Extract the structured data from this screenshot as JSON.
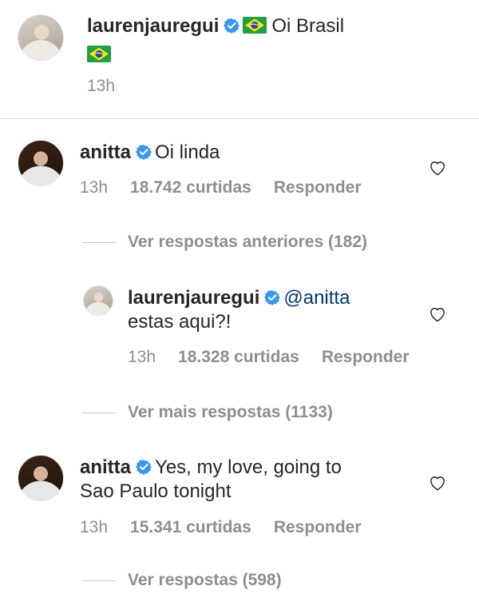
{
  "post": {
    "username": "laurenjauregui",
    "caption_text": "Oi Brasil",
    "time": "13h"
  },
  "comments": [
    {
      "username": "anitta",
      "text": "Oi linda",
      "time": "13h",
      "likes": "18.742 curtidas",
      "reply_label": "Responder",
      "replies_link": "Ver respostas anteriores (182)"
    },
    {
      "username": "laurenjauregui",
      "mention": "@anitta",
      "text": "estas aqui?!",
      "time": "13h",
      "likes": "18.328 curtidas",
      "reply_label": "Responder",
      "replies_link": "Ver mais respostas (1133)"
    },
    {
      "username": "anitta",
      "text_line1": "Yes, my love, going to",
      "text_line2": "Sao Paulo tonight",
      "time": "13h",
      "likes": "15.341 curtidas",
      "reply_label": "Responder",
      "replies_link": "Ver respostas (598)"
    }
  ],
  "colors": {
    "text": "#262626",
    "muted": "#8e8e8e",
    "verified": "#3897f0",
    "mention": "#003569"
  },
  "icons": {
    "verified": "verified-badge-icon",
    "flag": "brazil-flag-icon",
    "like": "heart-outline-icon"
  }
}
